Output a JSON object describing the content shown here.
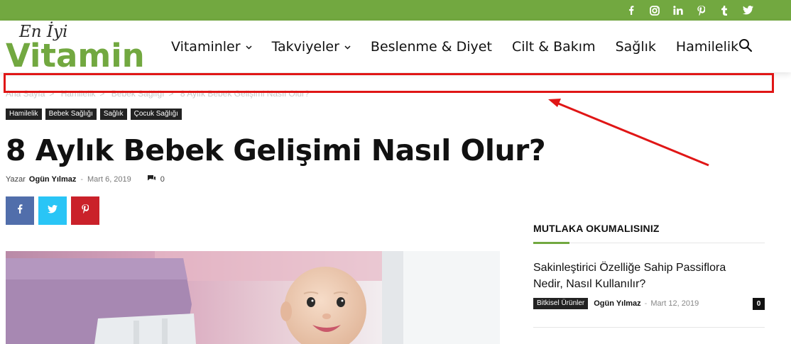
{
  "social": {
    "icons": [
      "facebook-icon",
      "instagram-icon",
      "linkedin-icon",
      "pinterest-icon",
      "tumblr-icon",
      "twitter-icon"
    ]
  },
  "logo": {
    "small": "En İyi",
    "big": "Vitamin",
    "color": "#72a840"
  },
  "nav": {
    "items": [
      {
        "label": "Vitaminler",
        "dropdown": true
      },
      {
        "label": "Takviyeler",
        "dropdown": true
      },
      {
        "label": "Beslenme & Diyet",
        "dropdown": false
      },
      {
        "label": "Cilt & Bakım",
        "dropdown": false
      },
      {
        "label": "Sağlık",
        "dropdown": false
      },
      {
        "label": "Hamilelik",
        "dropdown": false
      }
    ]
  },
  "breadcrumb": {
    "items": [
      "Ana Sayfa",
      "Hamilelik",
      "Bebek Sağlığı",
      "8 Aylık Bebek Gelişimi Nasıl Olur?"
    ],
    "separator": ">"
  },
  "article": {
    "categories": [
      "Hamilelik",
      "Bebek Sağlığı",
      "Sağlık",
      "Çocuk Sağlığı"
    ],
    "title": "8 Aylık Bebek Gelişimi Nasıl Olur?",
    "author_prefix": "Yazar",
    "author": "Ogün Yılmaz",
    "dash": "-",
    "date": "Mart 6, 2019",
    "comments": "0"
  },
  "sidebar": {
    "heading": "MUTLAKA OKUMALISINIZ",
    "post": {
      "title": "Sakinleştirici Özelliğe Sahip Passiflora Nedir, Nasıl Kullanılır?",
      "category": "Bitkisel Ürünler",
      "author": "Ogün Yılmaz",
      "dash": "-",
      "date": "Mart 12, 2019",
      "comments": "0"
    }
  },
  "colors": {
    "accent": "#72a840",
    "highlight": "#e01616",
    "facebook": "#516eab",
    "twitter": "#29c5f6",
    "pinterest": "#ca212a"
  }
}
